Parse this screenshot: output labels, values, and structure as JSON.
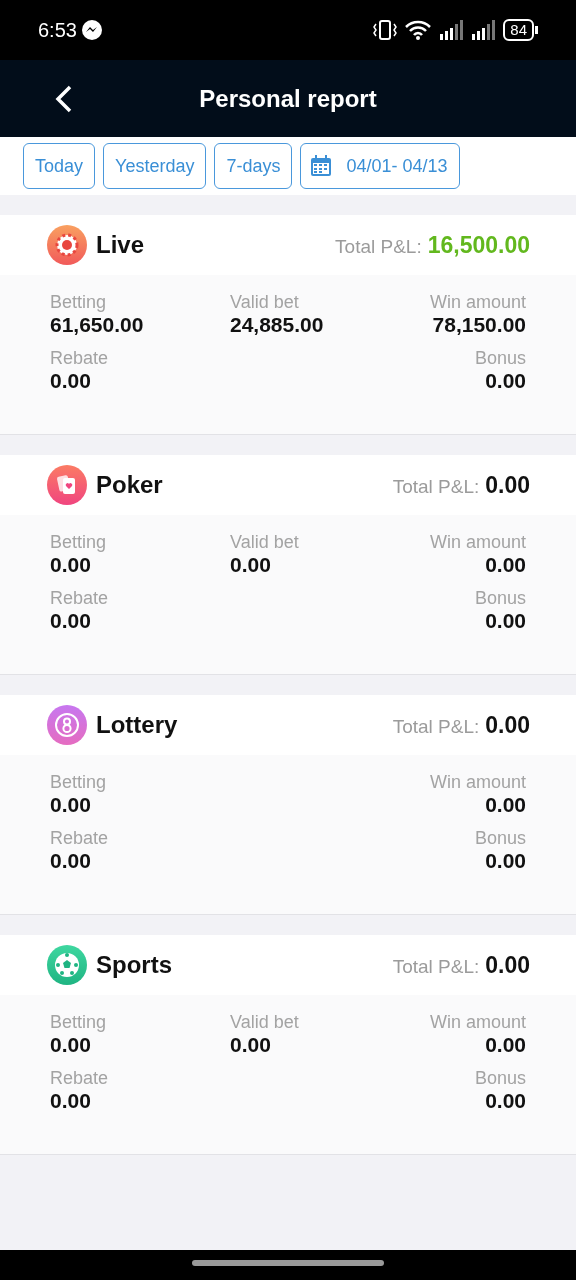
{
  "status_bar": {
    "time": "6:53",
    "battery": "84"
  },
  "header": {
    "title": "Personal report"
  },
  "filters": [
    {
      "label": "Today"
    },
    {
      "label": "Yesterday"
    },
    {
      "label": "7-days"
    },
    {
      "label": "04/01- 04/13",
      "kind": "date"
    }
  ],
  "sections": [
    {
      "kind": "live",
      "title": "Live",
      "total_label": "Total P&L:",
      "total": "16,500.00",
      "positive": true,
      "betting": {
        "label": "Betting",
        "value": "61,650.00"
      },
      "valid_bet": {
        "label": "Valid bet",
        "value": "24,885.00"
      },
      "win_amount": {
        "label": "Win amount",
        "value": "78,150.00"
      },
      "rebate": {
        "label": "Rebate",
        "value": "0.00"
      },
      "bonus": {
        "label": "Bonus",
        "value": "0.00"
      }
    },
    {
      "kind": "poker",
      "title": "Poker",
      "total_label": "Total P&L:",
      "total": "0.00",
      "positive": false,
      "betting": {
        "label": "Betting",
        "value": "0.00"
      },
      "valid_bet": {
        "label": "Valid bet",
        "value": "0.00"
      },
      "win_amount": {
        "label": "Win amount",
        "value": "0.00"
      },
      "rebate": {
        "label": "Rebate",
        "value": "0.00"
      },
      "bonus": {
        "label": "Bonus",
        "value": "0.00"
      }
    },
    {
      "kind": "lottery",
      "title": "Lottery",
      "total_label": "Total P&L:",
      "total": "0.00",
      "positive": false,
      "betting": {
        "label": "Betting",
        "value": "0.00"
      },
      "win_amount": {
        "label": "Win amount",
        "value": "0.00"
      },
      "rebate": {
        "label": "Rebate",
        "value": "0.00"
      },
      "bonus": {
        "label": "Bonus",
        "value": "0.00"
      }
    },
    {
      "kind": "sports",
      "title": "Sports",
      "total_label": "Total P&L:",
      "total": "0.00",
      "positive": false,
      "betting": {
        "label": "Betting",
        "value": "0.00"
      },
      "valid_bet": {
        "label": "Valid bet",
        "value": "0.00"
      },
      "win_amount": {
        "label": "Win amount",
        "value": "0.00"
      },
      "rebate": {
        "label": "Rebate",
        "value": "0.00"
      },
      "bonus": {
        "label": "Bonus",
        "value": "0.00"
      }
    }
  ]
}
